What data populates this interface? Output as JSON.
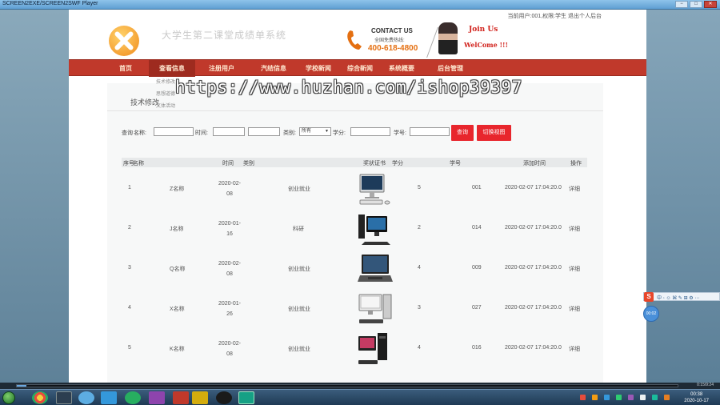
{
  "window": {
    "title": "SCREEN2EXE/SCREEN2SWF Player",
    "controls": [
      "−",
      "□",
      "✕"
    ]
  },
  "header": {
    "top_links": "当前用户:001,权限:学生  退出个人后台",
    "site_title": "大学生第二课堂成绩单系统",
    "contact_title": "CONTACT US",
    "contact_sub": "全国免费热线:",
    "contact_phone": "400-618-4800",
    "join_text": "Join Us",
    "welcome_text": "WelCome !!!"
  },
  "nav": {
    "items": [
      "首页",
      "查看信息",
      "注册用户",
      "汽结信息",
      "学校新闻",
      "综合新闻",
      "系统概要",
      "后台管理"
    ],
    "active_index": 1
  },
  "dropdown": {
    "items": [
      "技术修改",
      "思想道德",
      "文体活动"
    ]
  },
  "watermark": "https://www.huzhan.com/ishop39397",
  "panel": {
    "tab_label": "技术修改"
  },
  "search": {
    "prefix": "查询",
    "name_label": "名称:",
    "time_label": "时间:",
    "category_label": "类别:",
    "category_value": "所有",
    "credit_label": "学分:",
    "student_id_label": "学号:",
    "query_button": "查询",
    "switch_view_button": "切换视图"
  },
  "table": {
    "headers": [
      "序号",
      "名称",
      "时间",
      "类别",
      "奖状证书",
      "学分",
      "学号",
      "添加时间",
      "操作"
    ],
    "rows": [
      {
        "no": "1",
        "name": "Z名称",
        "date_line1": "2020-02-",
        "date_line2": "08",
        "category": "创业就业",
        "credit": "5",
        "student_id": "001",
        "added": "2020-02-07 17:04:20.0",
        "action": "详细",
        "image": "computer-icon"
      },
      {
        "no": "2",
        "name": "J名称",
        "date_line1": "2020-01-",
        "date_line2": "16",
        "category": "科研",
        "credit": "2",
        "student_id": "014",
        "added": "2020-02-07 17:04:20.0",
        "action": "详细",
        "image": "computer-icon"
      },
      {
        "no": "3",
        "name": "Q名称",
        "date_line1": "2020-02-",
        "date_line2": "08",
        "category": "创业就业",
        "credit": "4",
        "student_id": "009",
        "added": "2020-02-07 17:04:20.0",
        "action": "详细",
        "image": "laptop-icon"
      },
      {
        "no": "4",
        "name": "X名称",
        "date_line1": "2020-01-",
        "date_line2": "26",
        "category": "创业就业",
        "credit": "3",
        "student_id": "027",
        "added": "2020-02-07 17:04:20.0",
        "action": "详细",
        "image": "computer-icon"
      },
      {
        "no": "5",
        "name": "K名称",
        "date_line1": "2020-02-",
        "date_line2": "08",
        "category": "创业就业",
        "credit": "4",
        "student_id": "016",
        "added": "2020-02-07 17:04:20.0",
        "action": "详细",
        "image": "computer-icon"
      }
    ]
  },
  "ime": {
    "logo": "S",
    "text": "中 ◦ ☺ ⌘ ✎ ⊞ ⚙ ⋯"
  },
  "recorder": {
    "timer": "00:02"
  },
  "player": {
    "progress": 0.015,
    "time": "0:15/9:24"
  },
  "taskbar": {
    "time": "00:38",
    "date": "2020-10-17",
    "colors": {
      "accent": "#c0392b",
      "button": "#e8262d",
      "phone": "#e46f11"
    }
  }
}
